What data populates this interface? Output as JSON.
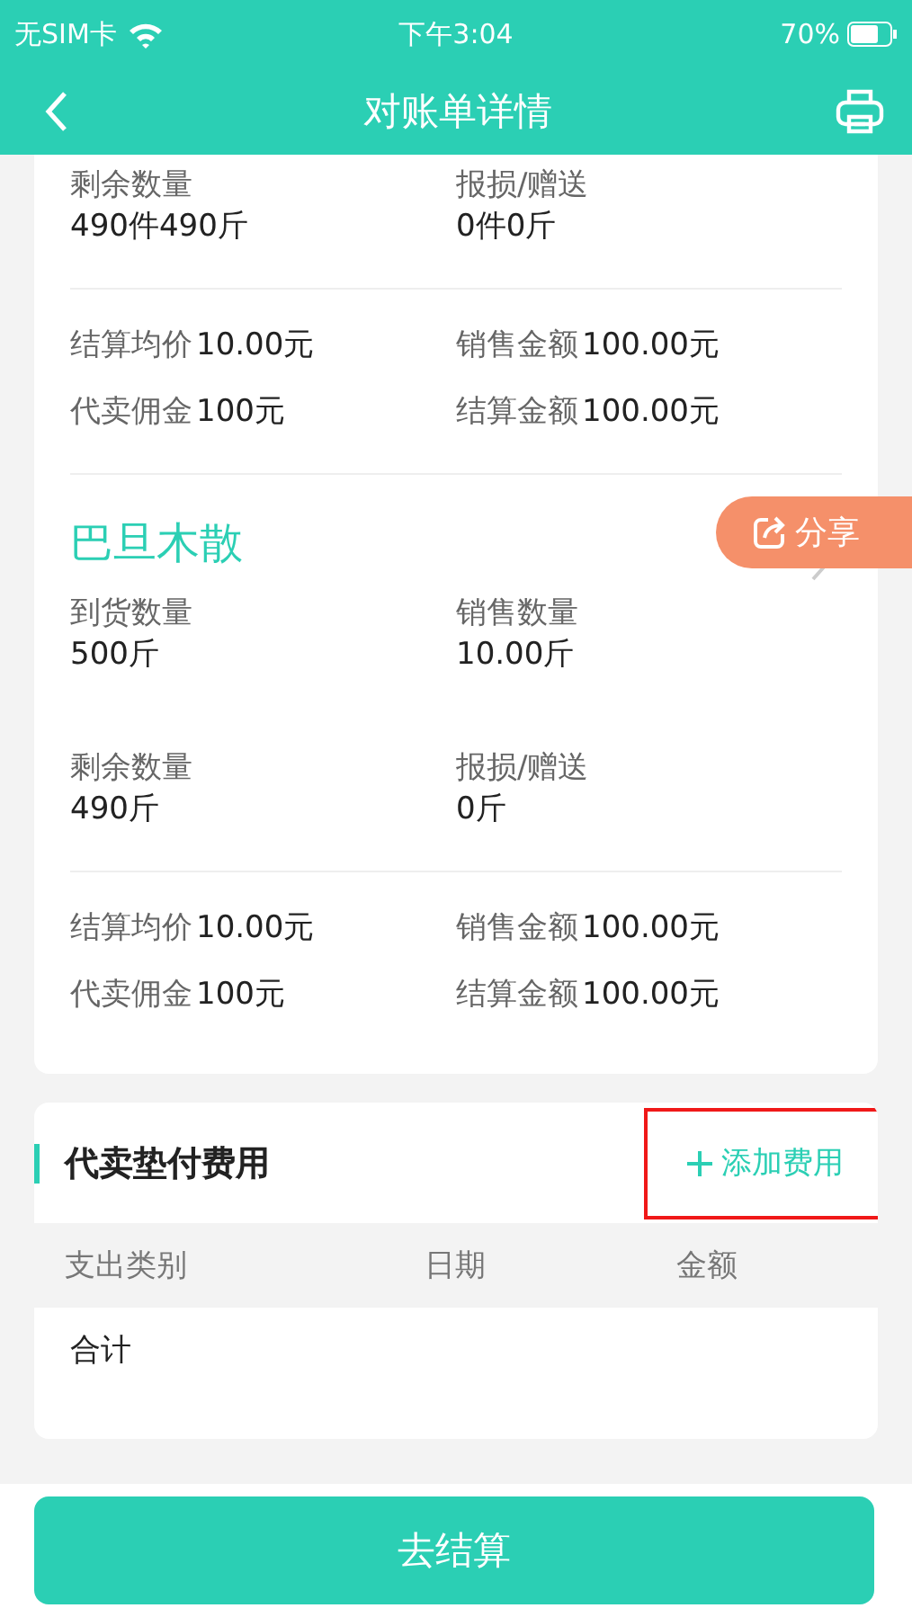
{
  "status_bar": {
    "carrier": "无SIM卡",
    "time": "下午3:04",
    "battery": "70%"
  },
  "nav": {
    "title": "对账单详情"
  },
  "products": [
    {
      "sections": [
        {
          "kind": "stacked",
          "items": [
            {
              "label": "剩余数量",
              "value": "490件490斤"
            },
            {
              "label": "报损/赠送",
              "value": "0件0斤"
            }
          ]
        },
        {
          "kind": "inline",
          "items": [
            {
              "label": "结算均价",
              "value": "10.00元"
            },
            {
              "label": "销售金额",
              "value": "100.00元"
            },
            {
              "label": "代卖佣金",
              "value": "100元"
            },
            {
              "label": "结算金额",
              "value": "100.00元"
            }
          ]
        }
      ]
    },
    {
      "name": "巴旦木散",
      "sections": [
        {
          "kind": "stacked",
          "items": [
            {
              "label": "到货数量",
              "value": "500斤"
            },
            {
              "label": "销售数量",
              "value": "10.00斤"
            },
            {
              "label": "剩余数量",
              "value": "490斤"
            },
            {
              "label": "报损/赠送",
              "value": "0斤"
            }
          ]
        },
        {
          "kind": "inline",
          "items": [
            {
              "label": "结算均价",
              "value": "10.00元"
            },
            {
              "label": "销售金额",
              "value": "100.00元"
            },
            {
              "label": "代卖佣金",
              "value": "100元"
            },
            {
              "label": "结算金额",
              "value": "100.00元"
            }
          ]
        }
      ]
    }
  ],
  "share_button": {
    "label": "分享"
  },
  "expenses": {
    "title": "代卖垫付费用",
    "add_button": {
      "label": "添加费用",
      "highlighted": true
    },
    "columns": [
      "支出类别",
      "日期",
      "金额"
    ],
    "total_label": "合计"
  },
  "submit_button": {
    "label": "去结算"
  }
}
